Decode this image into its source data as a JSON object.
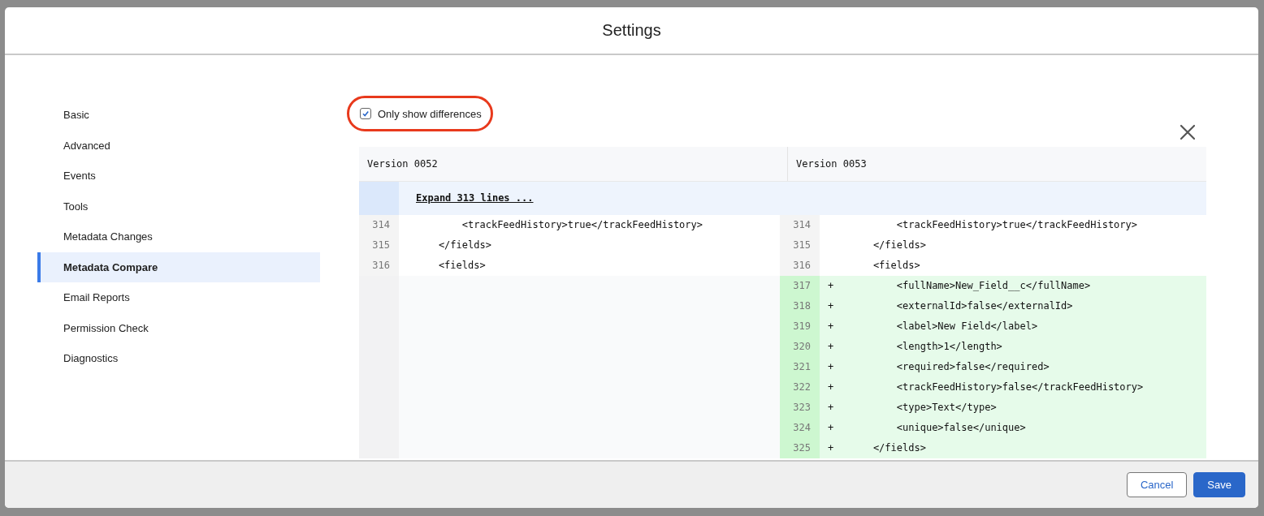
{
  "dialog": {
    "title": "Settings"
  },
  "sidebar": {
    "items": [
      {
        "label": "Basic",
        "selected": false
      },
      {
        "label": "Advanced",
        "selected": false
      },
      {
        "label": "Events",
        "selected": false
      },
      {
        "label": "Tools",
        "selected": false
      },
      {
        "label": "Metadata Changes",
        "selected": false
      },
      {
        "label": "Metadata Compare",
        "selected": true
      },
      {
        "label": "Email Reports",
        "selected": false
      },
      {
        "label": "Permission Check",
        "selected": false
      },
      {
        "label": "Diagnostics",
        "selected": false
      }
    ]
  },
  "filter": {
    "label": "Only show differences",
    "checked": true,
    "highlighted": true
  },
  "diff": {
    "columns": [
      "Version 0052",
      "Version 0053"
    ],
    "expand": "Expand 313 lines ...",
    "rows": [
      {
        "kind": "context",
        "left_number": "314",
        "left_text": "        <trackFeedHistory>true</trackFeedHistory>",
        "right_number": "314",
        "right_text": "        <trackFeedHistory>true</trackFeedHistory>"
      },
      {
        "kind": "context",
        "left_number": "315",
        "left_text": "    </fields>",
        "right_number": "315",
        "right_text": "    </fields>"
      },
      {
        "kind": "context",
        "left_number": "316",
        "left_text": "    <fields>",
        "right_number": "316",
        "right_text": "    <fields>"
      },
      {
        "kind": "added",
        "right_number": "317",
        "sign": "+",
        "right_text": "        <fullName>New_Field__c</fullName>"
      },
      {
        "kind": "added",
        "right_number": "318",
        "sign": "+",
        "right_text": "        <externalId>false</externalId>"
      },
      {
        "kind": "added",
        "right_number": "319",
        "sign": "+",
        "right_text": "        <label>New Field</label>"
      },
      {
        "kind": "added",
        "right_number": "320",
        "sign": "+",
        "right_text": "        <length>1</length>"
      },
      {
        "kind": "added",
        "right_number": "321",
        "sign": "+",
        "right_text": "        <required>false</required>"
      },
      {
        "kind": "added",
        "right_number": "322",
        "sign": "+",
        "right_text": "        <trackFeedHistory>false</trackFeedHistory>"
      },
      {
        "kind": "added",
        "right_number": "323",
        "sign": "+",
        "right_text": "        <type>Text</type>"
      },
      {
        "kind": "added",
        "right_number": "324",
        "sign": "+",
        "right_text": "        <unique>false</unique>"
      },
      {
        "kind": "added",
        "right_number": "325",
        "sign": "+",
        "right_text": "    </fields>"
      }
    ]
  },
  "buttons": [
    {
      "label": "Cancel",
      "kind": "secondary"
    },
    {
      "label": "Save",
      "kind": "primary"
    }
  ]
}
